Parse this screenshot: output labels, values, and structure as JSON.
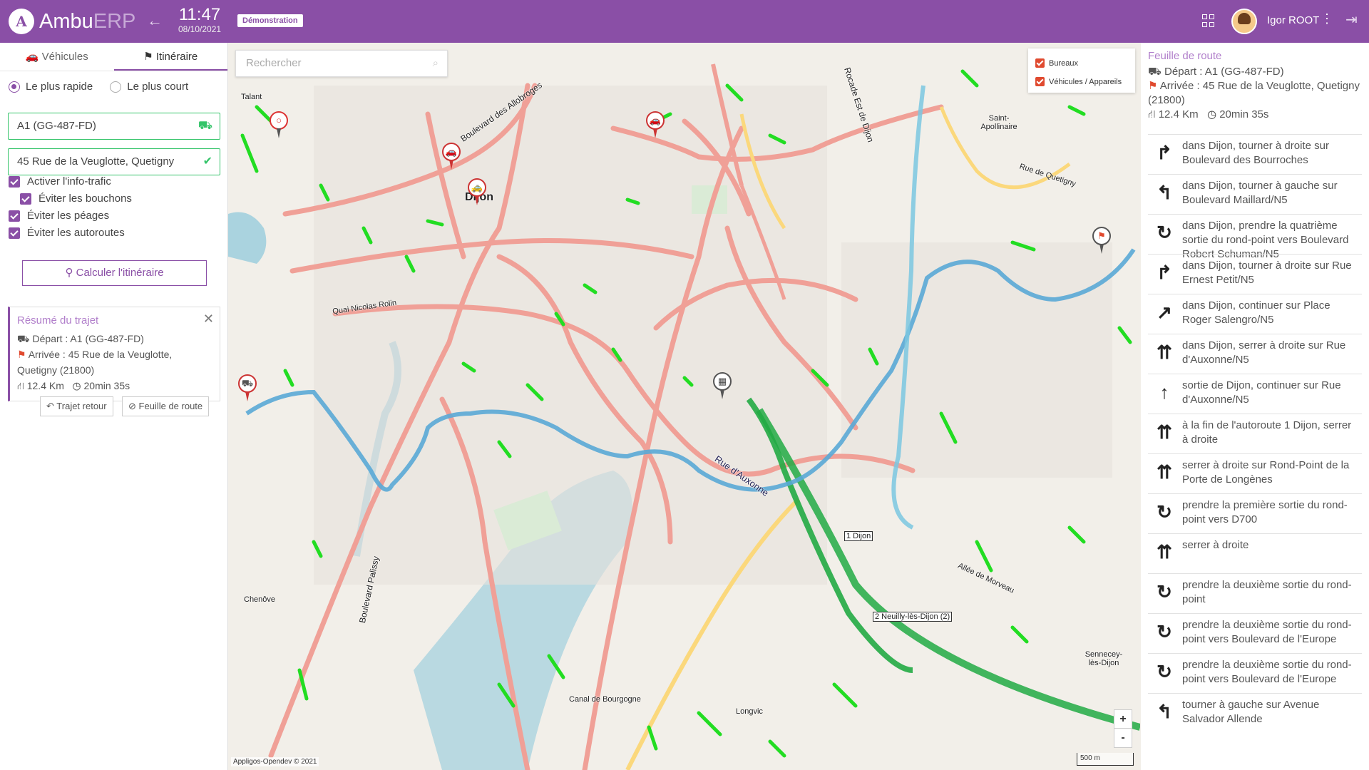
{
  "header": {
    "logo_letter": "A",
    "brand_main": "Ambu",
    "brand_sub": "ERP",
    "time": "11:47",
    "date": "08/10/2021",
    "demo_badge": "Démonstration",
    "user_name": "Igor ROOT"
  },
  "left": {
    "tabs": [
      {
        "label": "Véhicules",
        "icon": "car-icon"
      },
      {
        "label": "Itinéraire",
        "icon": "signpost-icon"
      }
    ],
    "route_modes": [
      "Le plus rapide",
      "Le plus court"
    ],
    "departure_value": "A1 (GG-487-FD)",
    "arrival_value": "45 Rue de la Veuglotte, Quetigny",
    "options": [
      "Activer l'info-trafic",
      "Éviter les bouchons",
      "Éviter les péages",
      "Éviter les autoroutes"
    ],
    "calculate_label": "Calculer l'itinéraire",
    "summary": {
      "title": "Résumé du trajet",
      "departure": "Départ : A1 (GG-487-FD)",
      "arrival": "Arrivée : 45 Rue de la Veuglotte, Quetigny (21800)",
      "distance": "12.4 Km",
      "duration": "20min 35s"
    },
    "return_trip_label": "Trajet retour",
    "roadsheet_label": "Feuille de route"
  },
  "map": {
    "search_placeholder": "Rechercher",
    "layers": [
      "Bureaux",
      "Véhicules / Appareils"
    ],
    "zoom_in": "+",
    "zoom_out": "-",
    "attribution": "Appligos-Opendev © 2021",
    "scale_label": "500 m",
    "labels": {
      "dijon": "Dijon",
      "talant": "Talant",
      "chenove": "Chenôve",
      "longvic": "Longvic",
      "saint_apollinaire": "Saint-Apollinaire",
      "quetigny": "Rue de Quetigny",
      "sennecey": "Sennecey-lès-Dijon",
      "rue_auxonne": "Rue d'Auxonne",
      "quai": "Quai Nicolas Rolin",
      "exit1": "1 Dijon",
      "exit2": "2 Neuilly-lès-Dijon (2)",
      "canal": "Canal de Bourgogne",
      "allee": "Allée de Morveau",
      "bd_allobroges": "Boulevard des Allobroges",
      "rocade": "Rocade Est de Dijon",
      "bd_palissy": "Boulevard Palissy"
    },
    "colors": {
      "route": "#5aa9d6",
      "highway": "#2ea043",
      "major_road": "#f0a097",
      "green_traffic": "#22dd22",
      "water": "#aad3df"
    }
  },
  "right": {
    "title": "Feuille de route",
    "departure": "Départ : A1 (GG-487-FD)",
    "arrival": "Arrivée : 45 Rue de la Veuglotte, Quetigny (21800)",
    "distance": "12.4 Km",
    "duration": "20min 35s",
    "steps": [
      {
        "icon": "turn-right-icon",
        "glyph": "↱",
        "text": "dans Dijon, tourner à droite sur Boulevard des Bourroches"
      },
      {
        "icon": "turn-left-icon",
        "glyph": "↰",
        "text": "dans Dijon, tourner à gauche sur Boulevard Maillard/N5"
      },
      {
        "icon": "roundabout-icon",
        "glyph": "↻",
        "text": "dans Dijon, prendre la quatrième sortie du rond-point vers Boulevard Robert Schuman/N5"
      },
      {
        "icon": "turn-right-icon",
        "glyph": "↱",
        "text": "dans Dijon, tourner à droite sur Rue Ernest Petit/N5"
      },
      {
        "icon": "slight-right-icon",
        "glyph": "↗",
        "text": "dans Dijon, continuer sur Place Roger Salengro/N5"
      },
      {
        "icon": "keep-right-icon",
        "glyph": "⇈",
        "text": "dans Dijon, serrer à droite sur Rue d'Auxonne/N5"
      },
      {
        "icon": "straight-icon",
        "glyph": "↑",
        "text": "sortie de Dijon, continuer sur Rue d'Auxonne/N5"
      },
      {
        "icon": "keep-right-icon",
        "glyph": "⇈",
        "text": "à la fin de l'autoroute 1 Dijon, serrer à droite"
      },
      {
        "icon": "keep-right-icon",
        "glyph": "⇈",
        "text": "serrer à droite sur Rond-Point de la Porte de Longènes"
      },
      {
        "icon": "roundabout-icon",
        "glyph": "↻",
        "text": "prendre la première sortie du rond-point vers D700"
      },
      {
        "icon": "keep-right-icon",
        "glyph": "⇈",
        "text": "serrer à droite"
      },
      {
        "icon": "roundabout-icon",
        "glyph": "↻",
        "text": "prendre la deuxième sortie du rond-point"
      },
      {
        "icon": "roundabout-icon",
        "glyph": "↻",
        "text": "prendre la deuxième sortie du rond-point vers Boulevard de l'Europe"
      },
      {
        "icon": "roundabout-icon",
        "glyph": "↻",
        "text": "prendre la deuxième sortie du rond-point vers Boulevard de l'Europe"
      },
      {
        "icon": "turn-left-icon",
        "glyph": "↰",
        "text": "tourner à gauche sur Avenue Salvador Allende"
      }
    ]
  }
}
